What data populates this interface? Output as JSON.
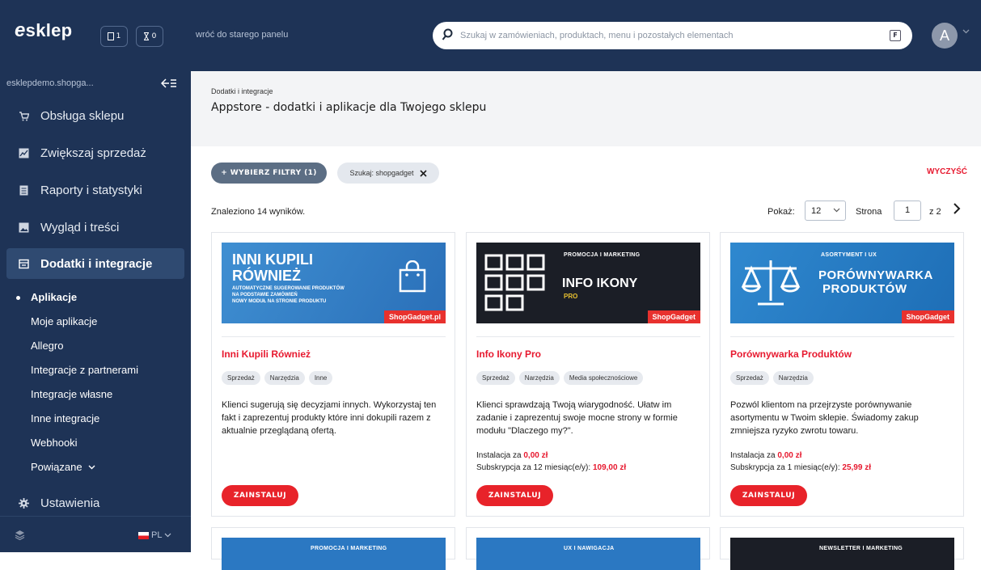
{
  "topbar": {
    "logo": "esklep",
    "badges": [
      {
        "icon": "document-icon",
        "count": "1"
      },
      {
        "icon": "hourglass-icon",
        "count": "0"
      }
    ],
    "old_panel_link": "wróć do starego panelu",
    "search_placeholder": "Szukaj w zamówieniach, produktach, menu i pozostałych elementach",
    "search_hotkey": "F",
    "avatar_letter": "A"
  },
  "sidebar": {
    "shop_name": "esklepdemo.shopga...",
    "items": [
      {
        "label": "Obsługa sklepu",
        "icon": "cart-icon"
      },
      {
        "label": "Zwiększaj sprzedaż",
        "icon": "chart-icon"
      },
      {
        "label": "Raporty i statystyki",
        "icon": "report-icon"
      },
      {
        "label": "Wygląd i treści",
        "icon": "image-icon"
      },
      {
        "label": "Dodatki i integracje",
        "icon": "addon-icon"
      },
      {
        "label": "Ustawienia",
        "icon": "gear-icon"
      }
    ],
    "subitems": [
      "Aplikacje",
      "Moje aplikacje",
      "Allegro",
      "Integracje z partnerami",
      "Integracje własne",
      "Inne integracje",
      "Webhooki",
      "Powiązane"
    ],
    "language": "PL"
  },
  "header": {
    "breadcrumb": "Dodatki i integracje",
    "title": "Appstore - dodatki i aplikacje dla Twojego sklepu"
  },
  "filters": {
    "button_label": "+ WYBIERZ FILTRY (1)",
    "chip_label": "Szukaj: shopgadget",
    "clear_label": "WYCZYŚĆ"
  },
  "results": {
    "found_text": "Znaleziono 14 wyników.",
    "show_label": "Pokaż:",
    "per_page": "12",
    "page_label": "Strona",
    "page": "1",
    "of_pages": "z 2"
  },
  "cards": [
    {
      "banner_title_1": "INNI KUPILI",
      "banner_title_2": "RÓWNIEŻ",
      "banner_lines": [
        "AUTOMATYCZNE SUGEROWANIE PRODUKTÓW",
        "NA PODSTAWIE ZAMÓWIEŃ",
        "NOWY MODUŁ NA STRONIE PRODUKTU"
      ],
      "banner_brand": "ShopGadget.pl",
      "title": "Inni Kupili Również",
      "tags": [
        "Sprzedaż",
        "Narzędzia",
        "Inne"
      ],
      "description": "Klienci sugerują się decyzjami innych. Wykorzystaj ten fakt i zaprezentuj produkty które inni dokupili razem z aktualnie przeglądaną ofertą.",
      "install_label": "ZAINSTALUJ"
    },
    {
      "banner_tag": "PROMOCJA I MARKETING",
      "banner_title": "INFO IKONY",
      "banner_sub": "PRO",
      "banner_brand": "ShopGadget",
      "title": "Info Ikony Pro",
      "tags": [
        "Sprzedaż",
        "Narzędzia",
        "Media społecznościowe"
      ],
      "description": "Klienci sprawdzają Twoją wiarygodność. Ułatw im zadanie i zaprezentuj swoje mocne strony w formie modułu \"Dlaczego my?\".",
      "install_price_label": "Instalacja za",
      "install_price": "0,00 zł",
      "subscription_label": "Subskrypcja za 12 miesiąc(e/y):",
      "subscription_price": "109,00 zł",
      "install_label": "ZAINSTALUJ"
    },
    {
      "banner_tag": "ASORTYMENT I UX",
      "banner_title_1": "PORÓWNYWARKA",
      "banner_title_2": "PRODUKTÓW",
      "banner_brand": "ShopGadget",
      "title": "Porównywarka Produktów",
      "tags": [
        "Sprzedaż",
        "Narzędzia"
      ],
      "description": "Pozwól klientom na przejrzyste porównywanie asortymentu w Twoim sklepie. Świadomy zakup zmniejsza ryzyko zwrotu towaru.",
      "install_price_label": "Instalacja za",
      "install_price": "0,00 zł",
      "subscription_label": "Subskrypcja za 1 miesiąc(e/y):",
      "subscription_price": "25,99 zł",
      "install_label": "ZAINSTALUJ"
    }
  ],
  "next_row_tags": [
    "PROMOCJA I MARKETING",
    "UX I NAWIGACJA",
    "NEWSLETTER I MARKETING"
  ]
}
